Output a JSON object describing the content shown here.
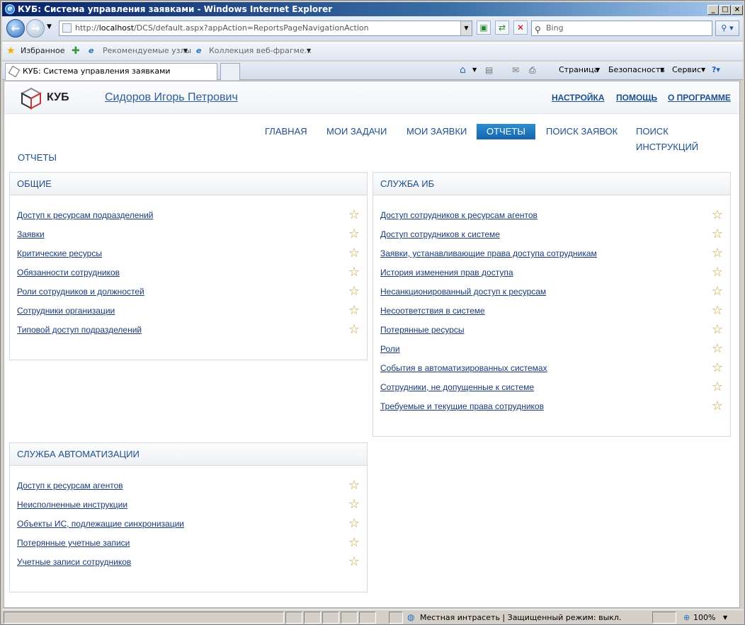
{
  "window": {
    "title": "КУБ: Система управления заявками - Windows Internet Explorer"
  },
  "address": {
    "prefix": "http://",
    "host": "localhost",
    "path": "/DCS/default.aspx?appAction=ReportsPageNavigationAction"
  },
  "search": {
    "placeholder": "Bing"
  },
  "favbar": {
    "favorites": "Избранное",
    "suggested": "Рекомендуемые узлы",
    "gallery": "Коллекция веб-фрагме..."
  },
  "tab": {
    "title": "КУБ: Система управления заявками"
  },
  "commands": {
    "page": "Страница",
    "safety": "Безопасность",
    "service": "Сервис"
  },
  "app": {
    "logo": "КУБ",
    "user": "Сидоров Игорь Петрович",
    "toplinks": [
      "НАСТРОЙКА",
      "ПОМОЩЬ",
      "О ПРОГРАММЕ"
    ],
    "menu": [
      "ГЛАВНАЯ",
      "МОИ ЗАДАЧИ",
      "МОИ ЗАЯВКИ",
      "ОТЧЕТЫ",
      "ПОИСК ЗАЯВОК",
      "ПОИСК ИНСТРУКЦИЙ"
    ],
    "active_menu": "ОТЧЕТЫ",
    "page_title": "ОТЧЕТЫ"
  },
  "panels": {
    "general": {
      "title": "ОБЩИЕ",
      "items": [
        "Доступ к ресурсам подразделений",
        "Заявки",
        "Критические ресурсы",
        "Обязанности сотрудников",
        "Роли сотрудников и должностей",
        "Сотрудники организации",
        "Типовой доступ подразделений"
      ]
    },
    "security": {
      "title": "СЛУЖБА ИБ",
      "items": [
        "Доступ сотрудников к ресурсам агентов",
        "Доступ сотрудников к системе",
        "Заявки, устанавливающие права доступа сотрудникам",
        "История изменения прав доступа",
        "Несанкционированный доступ к ресурсам",
        "Несоответствия в системе",
        "Потерянные ресурсы",
        "Роли",
        "События в автоматизированных системах",
        "Сотрудники, не допущенные к системе",
        "Требуемые и текущие права сотрудников"
      ]
    },
    "automation": {
      "title": "СЛУЖБА АВТОМАТИЗАЦИИ",
      "items": [
        "Доступ к ресурсам агентов",
        "Неисполненные инструкции",
        "Объекты ИС, подлежащие синхронизации",
        "Потерянные учетные записи",
        "Учетные записи сотрудников"
      ]
    }
  },
  "statusbar": {
    "zone": "Местная интрасеть | Защищенный режим: выкл.",
    "zoom": "100%"
  },
  "colors": {
    "link": "#1a3a77",
    "accent": "#1665ad",
    "star": "#c9a33c"
  }
}
